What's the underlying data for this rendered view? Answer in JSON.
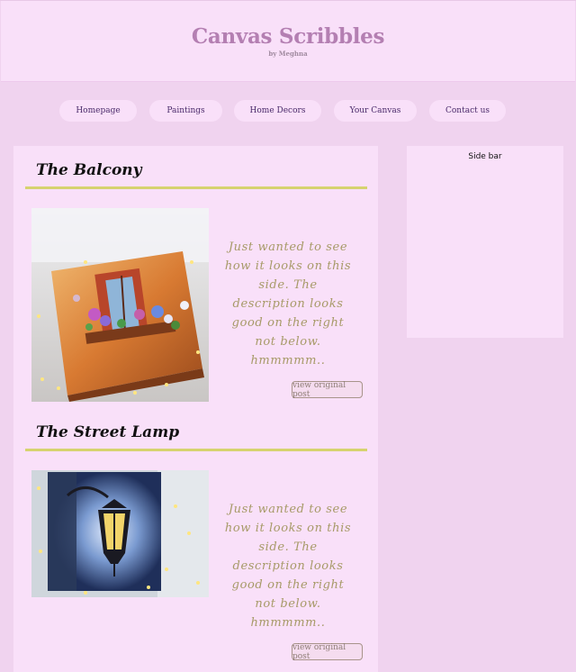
{
  "header": {
    "title": "Canvas Scribbles",
    "subtitle": "by Meghna"
  },
  "nav": {
    "items": [
      {
        "label": "Homepage"
      },
      {
        "label": "Paintings"
      },
      {
        "label": "Home Decors"
      },
      {
        "label": "Your Canvas"
      },
      {
        "label": "Contact us"
      }
    ]
  },
  "posts": [
    {
      "title": "The Balcony",
      "description": "Just wanted to see how it looks on this side. The description looks good on the right not below. hmmmmm..",
      "button_label": "view original post",
      "image_icon": "balcony-painting-image"
    },
    {
      "title": "The Street Lamp",
      "description": "Just wanted to see how it looks on this side. The description looks good on the right not below. hmmmmm..",
      "button_label": "view original post",
      "image_icon": "street-lamp-painting-image"
    }
  ],
  "sidebar": {
    "title": "Side bar"
  },
  "colors": {
    "page_bg": "#f0d3ef",
    "panel_bg": "#f9e0f9",
    "title_color": "#b47fb2",
    "rule_color": "#d6d36f",
    "desc_color": "#a79a68"
  }
}
